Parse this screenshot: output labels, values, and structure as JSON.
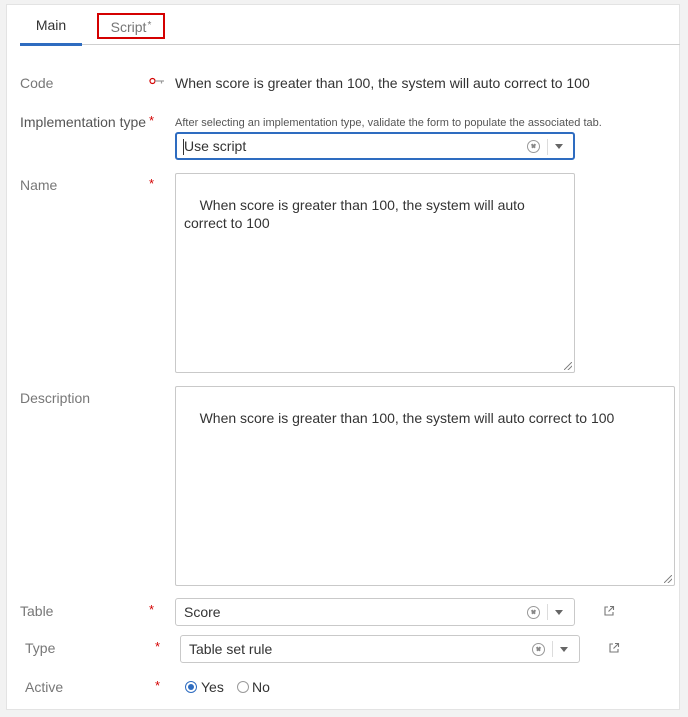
{
  "tabs": {
    "main_label": "Main",
    "script_label": "Script",
    "script_modified_mark": "*"
  },
  "form": {
    "required_mark": "*",
    "code": {
      "label": "Code",
      "value": "When score is greater than 100, the system will auto correct to 100",
      "icon": "key-icon"
    },
    "implementation_type": {
      "label": "Implementation type",
      "hint": "After selecting an implementation type, validate the form to populate the associated tab.",
      "value": "Use script"
    },
    "name": {
      "label": "Name",
      "value": "When score is greater than 100, the system will auto correct to 100"
    },
    "description": {
      "label": "Description",
      "value": "When score is greater than 100, the system will auto correct to 100"
    },
    "table": {
      "label": "Table",
      "value": "Score"
    },
    "type": {
      "label": "Type",
      "value": "Table set rule"
    },
    "active": {
      "label": "Active",
      "options": [
        "Yes",
        "No"
      ],
      "selected": "Yes"
    }
  },
  "colors": {
    "accent": "#2e6cc0",
    "required": "#d40000",
    "highlight_box": "#d40000"
  }
}
